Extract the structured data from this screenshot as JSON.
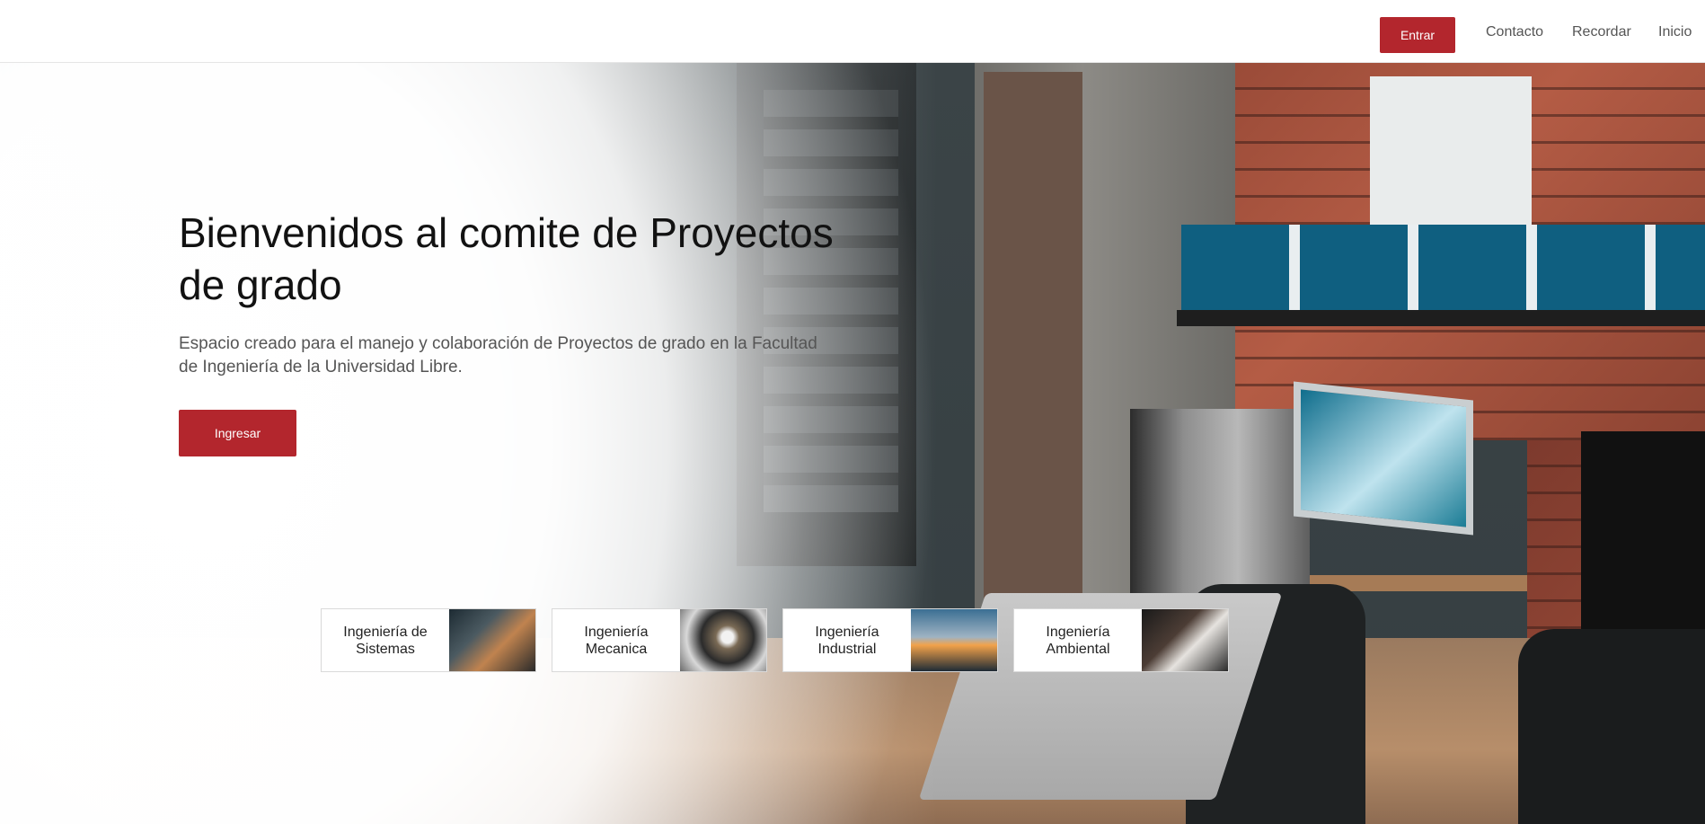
{
  "navbar": {
    "login_button": "Entrar",
    "links": [
      "Contacto",
      "Recordar",
      "Inicio"
    ]
  },
  "hero": {
    "title": "Bienvenidos al comite de Proyectos de grado",
    "subtitle": "Espacio creado para el manejo y colaboración de Proyectos de grado en la Facultad de Ingeniería de la Universidad Libre.",
    "cta_button": "Ingresar"
  },
  "cards": [
    {
      "label": "Ingeniería de Sistemas",
      "image": "server-room-photo"
    },
    {
      "label": "Ingeniería Mecanica",
      "image": "engine-part-photo"
    },
    {
      "label": "Ingeniería Industrial",
      "image": "port-cranes-sunset-photo"
    },
    {
      "label": "Ingeniería Ambiental",
      "image": "laboratory-glassware-photo"
    }
  ],
  "colors": {
    "accent": "#b3262d",
    "text": "#121212",
    "muted": "#555555"
  }
}
